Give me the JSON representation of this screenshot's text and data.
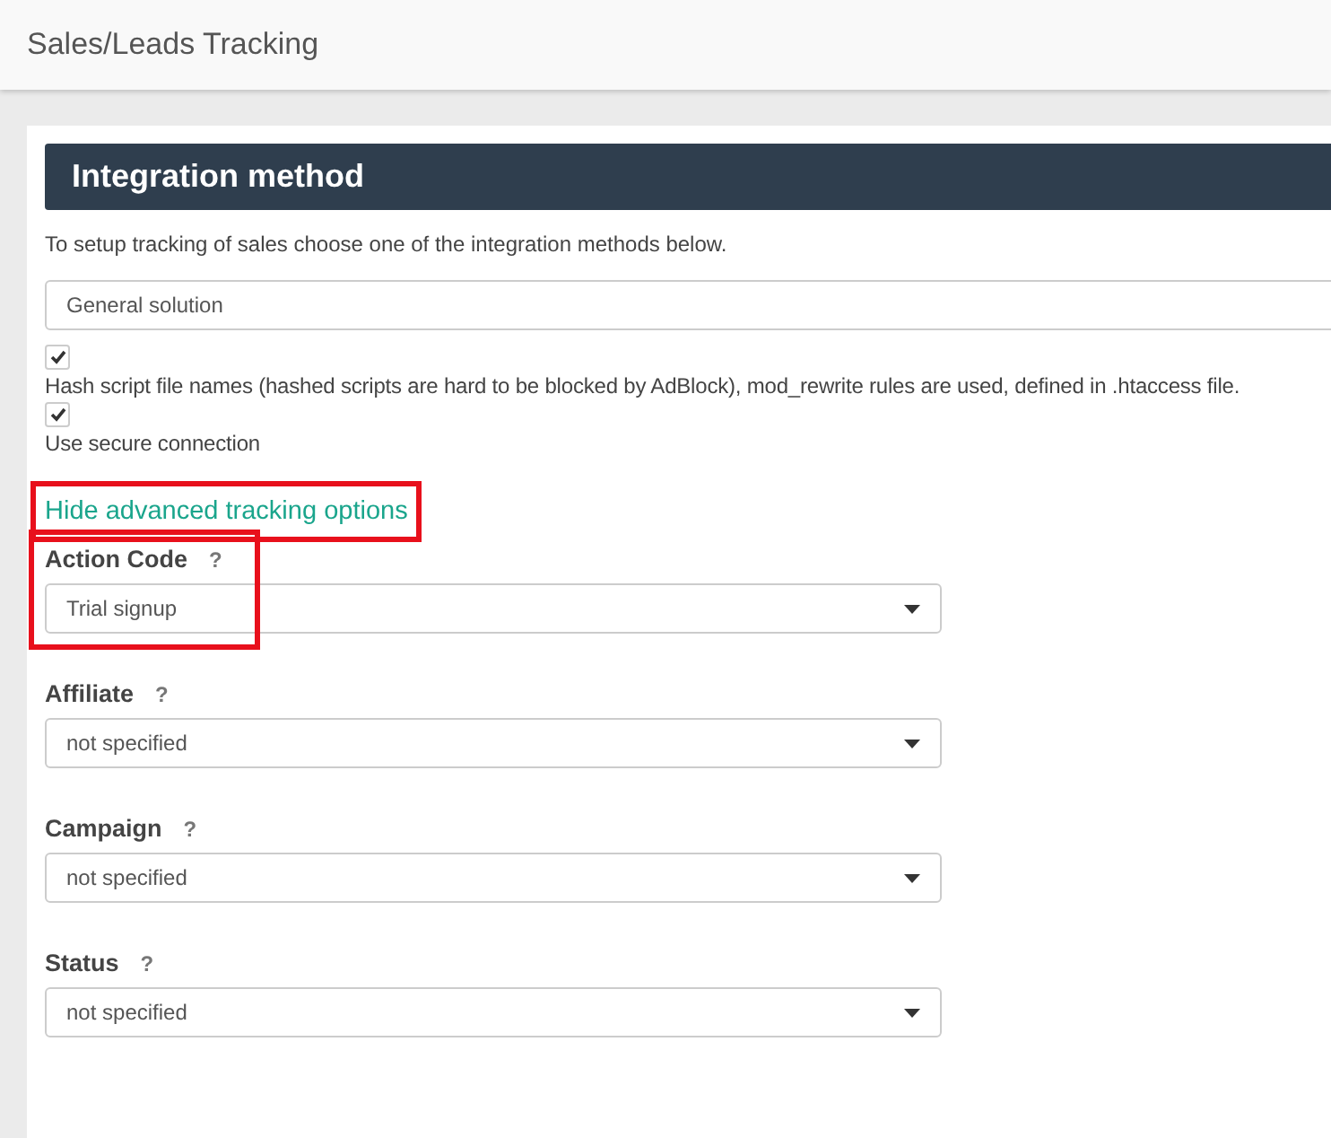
{
  "page": {
    "title": "Sales/Leads Tracking"
  },
  "section": {
    "title": "Integration method",
    "description": "To setup tracking of sales choose one of the integration methods below."
  },
  "method_select": {
    "value": "General solution"
  },
  "checkboxes": [
    {
      "label": "Hash script file names (hashed scripts are hard to be blocked by AdBlock), mod_rewrite rules are used, defined in .htaccess file.",
      "checked": true
    },
    {
      "label": "Use secure connection",
      "checked": true
    }
  ],
  "advanced_link": {
    "label": "Hide advanced tracking options",
    "highlighted": true
  },
  "fields": [
    {
      "label": "Action Code",
      "help": "?",
      "value": "Trial signup",
      "highlighted": true
    },
    {
      "label": "Affiliate",
      "help": "?",
      "value": "not specified",
      "highlighted": false
    },
    {
      "label": "Campaign",
      "help": "?",
      "value": "not specified",
      "highlighted": false
    },
    {
      "label": "Status",
      "help": "?",
      "value": "not specified",
      "highlighted": false
    }
  ]
}
